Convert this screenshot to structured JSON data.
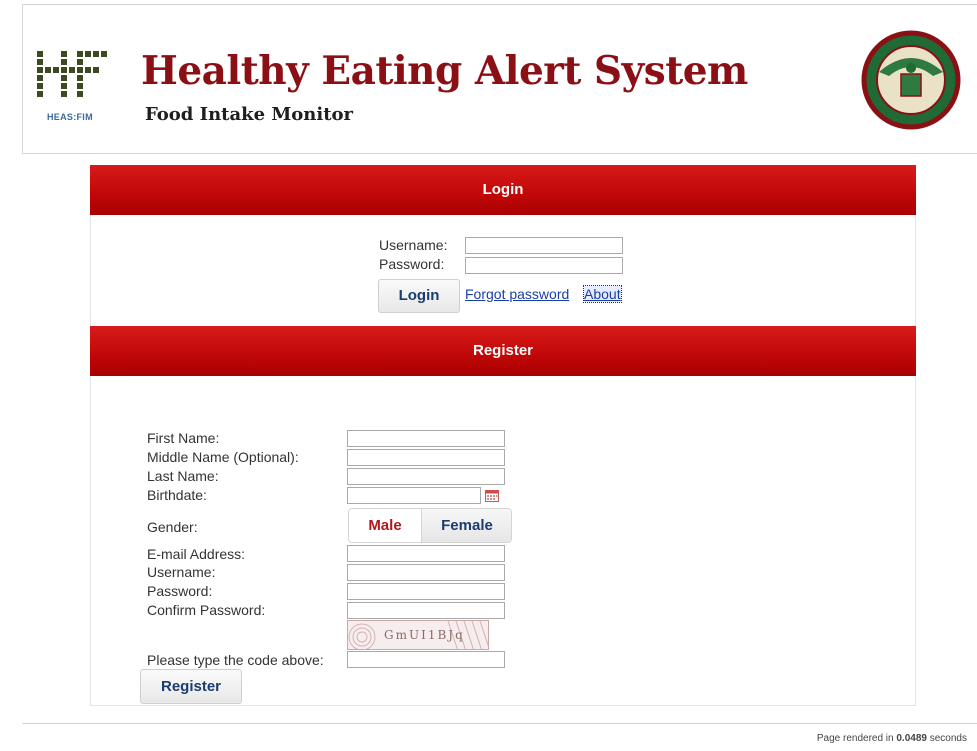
{
  "header": {
    "logo_caption": "HEAS:FIM",
    "title": "Healthy Eating Alert System",
    "subtitle": "Food Intake Monitor",
    "seal_lettering": "UNIVERSITY OF THE PHILIPPINES MANILA"
  },
  "login": {
    "heading": "Login",
    "username_label": "Username:",
    "password_label": "Password:",
    "username_value": "",
    "password_value": "",
    "login_button": "Login",
    "forgot_link": "Forgot password",
    "about_link": "About"
  },
  "register": {
    "heading": "Register",
    "first_name_label": "First Name:",
    "middle_name_label": "Middle Name (Optional):",
    "last_name_label": "Last Name:",
    "birthdate_label": "Birthdate:",
    "gender_label": "Gender:",
    "gender_options": [
      "Male",
      "Female"
    ],
    "gender_selected": "Male",
    "email_label": "E-mail Address:",
    "username_label": "Username:",
    "password_label": "Password:",
    "confirm_password_label": "Confirm Password:",
    "captcha_text": "GmUI1BJq",
    "captcha_label": "Please type the code above:",
    "register_button": "Register"
  },
  "footer": {
    "prefix": "Page rendered in ",
    "time": "0.0489",
    "suffix": " seconds"
  },
  "colors": {
    "bar_red": "#c00707",
    "title_red": "#8b1015",
    "male_red": "#b0181c",
    "link_blue": "#1a3ea8",
    "button_text": "#1a3c6e"
  },
  "icons": [
    "calendar-icon"
  ]
}
